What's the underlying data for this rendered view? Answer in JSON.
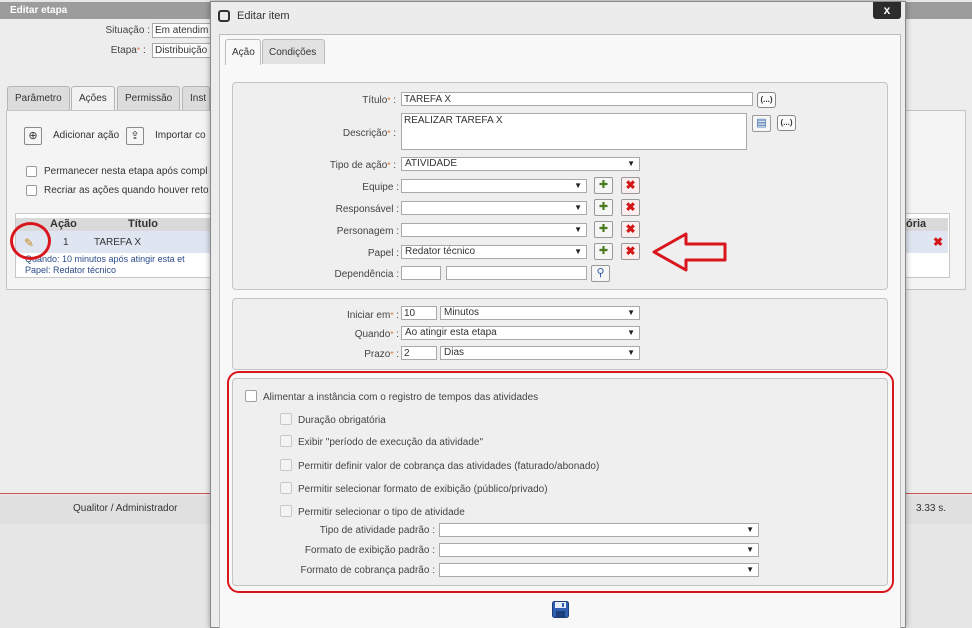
{
  "background": {
    "title": "Editar etapa",
    "situacao_label": "Situação :",
    "situacao_value": "Em atendim",
    "etapa_label": "Etapa",
    "etapa_value": "Distribuição",
    "tabs": [
      "Parâmetro",
      "Ações",
      "Permissão",
      "Inst"
    ],
    "add_action": "Adicionar ação",
    "import_action": "Importar co",
    "checkbox1": "Permanecer nesta etapa após compl",
    "checkbox2": "Recriar as ações quando houver reto",
    "table": {
      "col_acao": "Ação",
      "col_titulo": "Título",
      "col_right": "ória",
      "row_num": "1",
      "row_title": "TAREFA X",
      "row_detail1": "Quando: 10 minutos após atingir esta et",
      "row_detail2": "Papel: Redator técnico"
    },
    "footer_user": "Qualitor / Administrador",
    "footer_time": "3.33 s."
  },
  "modal": {
    "title": "Editar item",
    "close": "x",
    "tabs": [
      "Ação",
      "Condições"
    ],
    "form": {
      "titulo_label": "Título",
      "titulo_value": "TAREFA X",
      "descricao_label": "Descrição",
      "descricao_value": "REALIZAR TAREFA X",
      "tipo_label": "Tipo de ação",
      "tipo_value": "ATIVIDADE",
      "equipe_label": "Equipe :",
      "equipe_value": "",
      "responsavel_label": "Responsável :",
      "responsavel_value": "",
      "personagem_label": "Personagem :",
      "personagem_value": "",
      "papel_label": "Papel :",
      "papel_value": "Redator técnico",
      "dependencia_label": "Dependência :",
      "dependencia_code": "",
      "dependencia_name": "",
      "dots": "(...)"
    },
    "timing": {
      "iniciar_label": "Iniciar em",
      "iniciar_value": "10",
      "iniciar_unit": "Minutos",
      "quando_label": "Quando",
      "quando_value": "Ao atingir esta etapa",
      "prazo_label": "Prazo",
      "prazo_value": "2",
      "prazo_unit": "Dias"
    },
    "options": {
      "alimentar": "Alimentar a instância com o registro de tempos das atividades",
      "duracao": "Duração obrigatória",
      "exibir": "Exibir \"período de execução da atividade\"",
      "cobranca": "Permitir definir valor de cobrança das atividades (faturado/abonado)",
      "formato": "Permitir selecionar formato de exibição (público/privado)",
      "tipo": "Permitir selecionar o tipo de atividade",
      "tipo_padrao_label": "Tipo de atividade padrão :",
      "tipo_padrao_value": "",
      "formato_padrao_label": "Formato de exibição padrão :",
      "formato_padrao_value": "",
      "cobranca_padrao_label": "Formato de cobrança padrão :",
      "cobranca_padrao_value": ""
    }
  },
  "icons": {
    "save": "save-icon",
    "edit": "pencil-icon",
    "add": "add-icon",
    "remove": "remove-icon",
    "search": "search-icon",
    "book": "book-icon"
  },
  "colors": {
    "annotation_red": "#d9161c",
    "remove_red": "#d31515"
  }
}
